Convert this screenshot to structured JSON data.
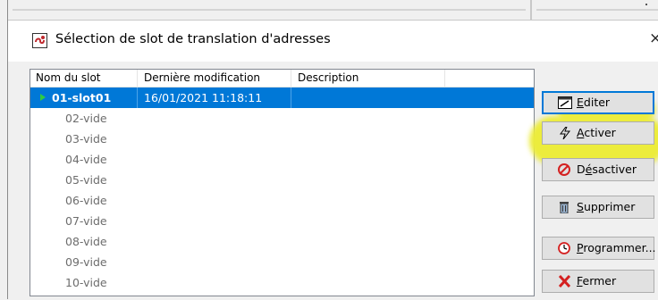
{
  "window": {
    "title": "Sélection de slot de translation d'adresses",
    "close_glyph": "×"
  },
  "table": {
    "columns": [
      "Nom du slot",
      "Dernière modification",
      "Description"
    ],
    "rows": [
      {
        "name": "01-slot01",
        "modified": "16/01/2021 11:18:11",
        "description": "",
        "selected": true
      },
      {
        "name": "02-vide",
        "modified": "",
        "description": ""
      },
      {
        "name": "03-vide",
        "modified": "",
        "description": ""
      },
      {
        "name": "04-vide",
        "modified": "",
        "description": ""
      },
      {
        "name": "05-vide",
        "modified": "",
        "description": ""
      },
      {
        "name": "06-vide",
        "modified": "",
        "description": ""
      },
      {
        "name": "07-vide",
        "modified": "",
        "description": ""
      },
      {
        "name": "08-vide",
        "modified": "",
        "description": ""
      },
      {
        "name": "09-vide",
        "modified": "",
        "description": ""
      },
      {
        "name": "10-vide",
        "modified": "",
        "description": ""
      }
    ]
  },
  "buttons": {
    "edit": {
      "mnemonic": "E",
      "rest": "diter",
      "icon": "edit-icon"
    },
    "activate": {
      "mnemonic": "A",
      "rest": "ctiver",
      "icon": "lightning-icon"
    },
    "deactivate": {
      "pre": "D",
      "mnemonic": "é",
      "rest": "sactiver",
      "icon": "no-entry-icon"
    },
    "delete": {
      "mnemonic": "S",
      "rest": "upprimer",
      "icon": "trash-icon"
    },
    "schedule": {
      "mnemonic": "P",
      "rest": "rogrammer...",
      "icon": "clock-icon"
    },
    "close": {
      "mnemonic": "F",
      "rest": "ermer",
      "icon": "red-x-icon"
    }
  },
  "colors": {
    "selection": "#0078d7",
    "highlight": "#ecec3c",
    "play_marker": "#2ecc40"
  }
}
